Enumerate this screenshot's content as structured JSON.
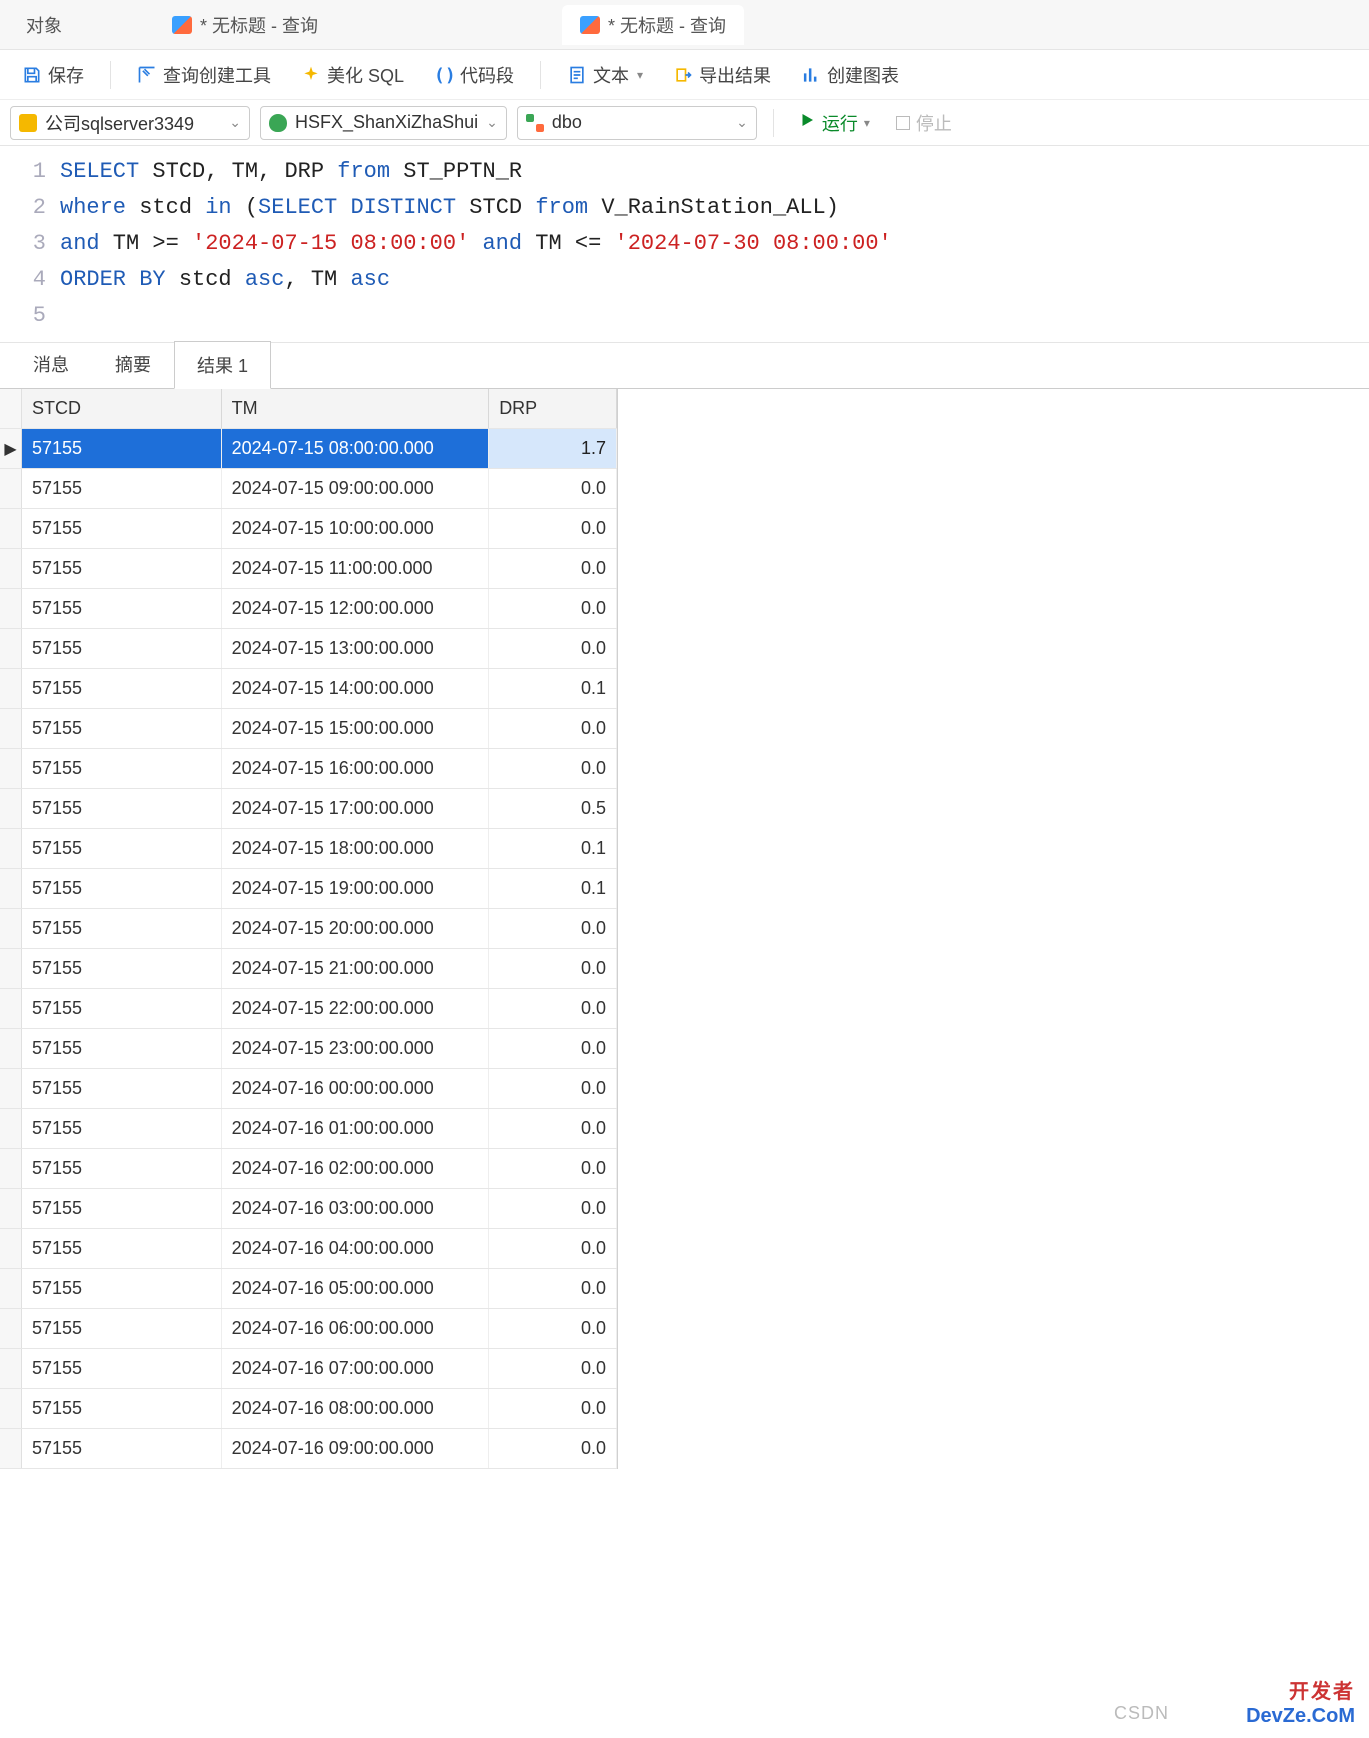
{
  "tabs": {
    "object_label": "对象",
    "items": [
      {
        "label": "* 无标题 - 查询",
        "active": false
      },
      {
        "label": "* 无标题 - 查询",
        "active": true
      }
    ]
  },
  "toolbar": {
    "save": "保存",
    "query_builder": "查询创建工具",
    "beautify": "美化 SQL",
    "snippet": "代码段",
    "text": "文本",
    "export": "导出结果",
    "chart": "创建图表"
  },
  "conn": {
    "server": "公司sqlserver3349",
    "database": "HSFX_ShanXiZhaShui",
    "schema": "dbo",
    "run": "运行",
    "stop": "停止"
  },
  "sql": {
    "lines": [
      "1",
      "2",
      "3",
      "4",
      "5"
    ],
    "l1a": "SELECT",
    "l1b": " STCD, TM, DRP ",
    "l1c": "from",
    "l1d": " ST_PPTN_R",
    "l2a": "where",
    "l2b": " stcd ",
    "l2c": "in",
    "l2d": " (",
    "l2e": "SELECT DISTINCT",
    "l2f": " STCD ",
    "l2g": "from",
    "l2h": " V_RainStation_ALL)",
    "l3a": "and",
    "l3b": " TM >= ",
    "l3c": "'2024-07-15 08:00:00'",
    "l3d": " and",
    "l3e": " TM <= ",
    "l3f": "'2024-07-30 08:00:00'",
    "l4a": "ORDER BY",
    "l4b": " stcd ",
    "l4c": "asc",
    "l4d": ", TM ",
    "l4e": "asc"
  },
  "result_tabs": {
    "messages": "消息",
    "summary": "摘要",
    "result1": "结果 1"
  },
  "grid": {
    "headers": {
      "stcd": "STCD",
      "tm": "TM",
      "drp": "DRP"
    },
    "rows": [
      {
        "stcd": "57155",
        "tm": "2024-07-15 08:00:00.000",
        "drp": "1.7"
      },
      {
        "stcd": "57155",
        "tm": "2024-07-15 09:00:00.000",
        "drp": "0.0"
      },
      {
        "stcd": "57155",
        "tm": "2024-07-15 10:00:00.000",
        "drp": "0.0"
      },
      {
        "stcd": "57155",
        "tm": "2024-07-15 11:00:00.000",
        "drp": "0.0"
      },
      {
        "stcd": "57155",
        "tm": "2024-07-15 12:00:00.000",
        "drp": "0.0"
      },
      {
        "stcd": "57155",
        "tm": "2024-07-15 13:00:00.000",
        "drp": "0.0"
      },
      {
        "stcd": "57155",
        "tm": "2024-07-15 14:00:00.000",
        "drp": "0.1"
      },
      {
        "stcd": "57155",
        "tm": "2024-07-15 15:00:00.000",
        "drp": "0.0"
      },
      {
        "stcd": "57155",
        "tm": "2024-07-15 16:00:00.000",
        "drp": "0.0"
      },
      {
        "stcd": "57155",
        "tm": "2024-07-15 17:00:00.000",
        "drp": "0.5"
      },
      {
        "stcd": "57155",
        "tm": "2024-07-15 18:00:00.000",
        "drp": "0.1"
      },
      {
        "stcd": "57155",
        "tm": "2024-07-15 19:00:00.000",
        "drp": "0.1"
      },
      {
        "stcd": "57155",
        "tm": "2024-07-15 20:00:00.000",
        "drp": "0.0"
      },
      {
        "stcd": "57155",
        "tm": "2024-07-15 21:00:00.000",
        "drp": "0.0"
      },
      {
        "stcd": "57155",
        "tm": "2024-07-15 22:00:00.000",
        "drp": "0.0"
      },
      {
        "stcd": "57155",
        "tm": "2024-07-15 23:00:00.000",
        "drp": "0.0"
      },
      {
        "stcd": "57155",
        "tm": "2024-07-16 00:00:00.000",
        "drp": "0.0"
      },
      {
        "stcd": "57155",
        "tm": "2024-07-16 01:00:00.000",
        "drp": "0.0"
      },
      {
        "stcd": "57155",
        "tm": "2024-07-16 02:00:00.000",
        "drp": "0.0"
      },
      {
        "stcd": "57155",
        "tm": "2024-07-16 03:00:00.000",
        "drp": "0.0"
      },
      {
        "stcd": "57155",
        "tm": "2024-07-16 04:00:00.000",
        "drp": "0.0"
      },
      {
        "stcd": "57155",
        "tm": "2024-07-16 05:00:00.000",
        "drp": "0.0"
      },
      {
        "stcd": "57155",
        "tm": "2024-07-16 06:00:00.000",
        "drp": "0.0"
      },
      {
        "stcd": "57155",
        "tm": "2024-07-16 07:00:00.000",
        "drp": "0.0"
      },
      {
        "stcd": "57155",
        "tm": "2024-07-16 08:00:00.000",
        "drp": "0.0"
      },
      {
        "stcd": "57155",
        "tm": "2024-07-16 09:00:00.000",
        "drp": "0.0"
      }
    ]
  },
  "watermark": {
    "line1": "开发者",
    "line2": "DevZe.CoM",
    "csdn": "CSDN"
  }
}
